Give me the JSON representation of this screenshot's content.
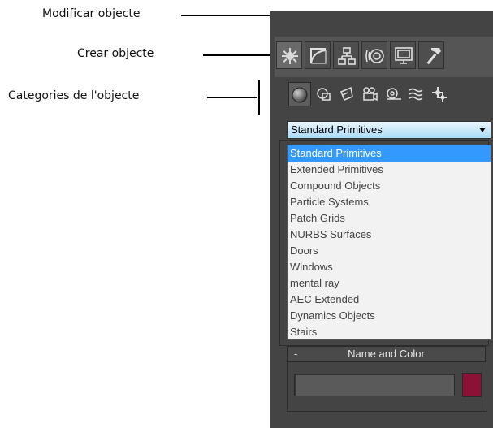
{
  "annotations": {
    "modify": "Modificar objecte",
    "create": "Crear objecte",
    "categories": "Categories de l'objecte"
  },
  "command_panel": {
    "tabs": [
      {
        "name": "create",
        "icon": "create-icon"
      },
      {
        "name": "modify",
        "icon": "modify-icon"
      },
      {
        "name": "hierarchy",
        "icon": "hierarchy-icon"
      },
      {
        "name": "motion",
        "icon": "motion-icon"
      },
      {
        "name": "display",
        "icon": "display-icon"
      },
      {
        "name": "utilities",
        "icon": "hammer-icon"
      }
    ],
    "categories": [
      {
        "name": "geometry",
        "icon": "sphere-icon"
      },
      {
        "name": "shapes",
        "icon": "shapes-icon"
      },
      {
        "name": "lights",
        "icon": "light-icon"
      },
      {
        "name": "cameras",
        "icon": "camera-icon"
      },
      {
        "name": "helpers",
        "icon": "tape-helper-icon"
      },
      {
        "name": "space-warps",
        "icon": "wave-icon"
      },
      {
        "name": "systems",
        "icon": "gear-icon"
      }
    ],
    "dropdown": {
      "selected": "Standard Primitives",
      "options": [
        "Standard Primitives",
        "Extended Primitives",
        "Compound Objects",
        "Particle Systems",
        "Patch Grids",
        "NURBS Surfaces",
        "Doors",
        "Windows",
        "mental ray",
        "AEC Extended",
        "Dynamics Objects",
        "Stairs"
      ]
    },
    "name_and_color": {
      "toggle": "-",
      "title": "Name and Color",
      "name_value": "",
      "color": "#8c1136"
    }
  },
  "colors": {
    "panel_bg": "#444444",
    "highlight": "#3399ff",
    "dropdown_gradient_top": "#eaf6ff",
    "dropdown_gradient_bottom": "#a9dbf6"
  }
}
